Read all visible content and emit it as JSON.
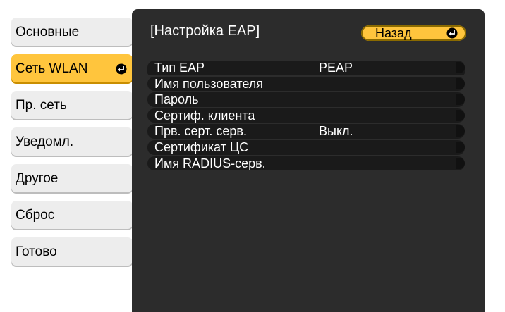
{
  "sidebar": {
    "items": [
      {
        "label": "Основные"
      },
      {
        "label": "Сеть WLAN"
      },
      {
        "label": "Пр. сеть"
      },
      {
        "label": "Уведомл."
      },
      {
        "label": "Другое"
      },
      {
        "label": "Сброс"
      },
      {
        "label": "Готово"
      }
    ],
    "selected_index": 1
  },
  "panel": {
    "title": "[Настройка EAP]",
    "back_label": "Назад"
  },
  "settings": [
    {
      "label": "Тип EAP",
      "value": "PEAP"
    },
    {
      "label": "Имя пользователя",
      "value": ""
    },
    {
      "label": "Пароль",
      "value": ""
    },
    {
      "label": "Сертиф. клиента",
      "value": ""
    },
    {
      "label": "Прв. серт. серв.",
      "value": "Выкл."
    },
    {
      "label": "Сертификат ЦС",
      "value": ""
    },
    {
      "label": "Имя RADIUS-серв.",
      "value": ""
    }
  ],
  "colors": {
    "accent": "#ffc53d",
    "panel_bg": "#2c2c2c",
    "row_bg": "#1a1a1a",
    "sidebar_bg": "#ededed"
  }
}
